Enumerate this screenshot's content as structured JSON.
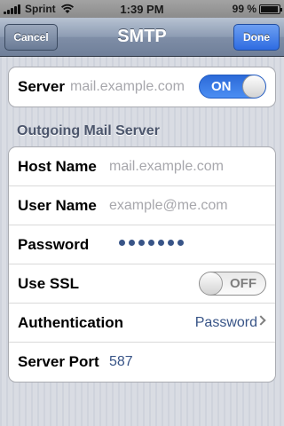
{
  "status_bar": {
    "carrier": "Sprint",
    "time": "1:39 PM",
    "battery_text": "99 %",
    "battery_level": 0.99
  },
  "nav": {
    "title": "SMTP",
    "cancel_label": "Cancel",
    "done_label": "Done"
  },
  "server_group": {
    "label": "Server",
    "placeholder": "mail.example.com",
    "toggle_label": "ON",
    "toggle_state": "on"
  },
  "outgoing": {
    "header": "Outgoing Mail Server",
    "rows": [
      {
        "label": "Host Name",
        "value": "mail.example.com",
        "is_placeholder": true
      },
      {
        "label": "User Name",
        "value": "example@me.com",
        "is_placeholder": true
      },
      {
        "label": "Password",
        "value": "●●●●●●●",
        "masked_length": 7
      },
      {
        "label": "Use SSL",
        "toggle_label": "OFF",
        "toggle_state": "off"
      },
      {
        "label": "Authentication",
        "value": "Password",
        "icon": "chevron-right-icon"
      },
      {
        "label": "Server Port",
        "value": "587"
      }
    ]
  },
  "colors": {
    "accent_blue": "#2f6ce1",
    "value_blue": "#385487",
    "placeholder_gray": "#a7a7ac",
    "header_text": "#4c566c"
  }
}
